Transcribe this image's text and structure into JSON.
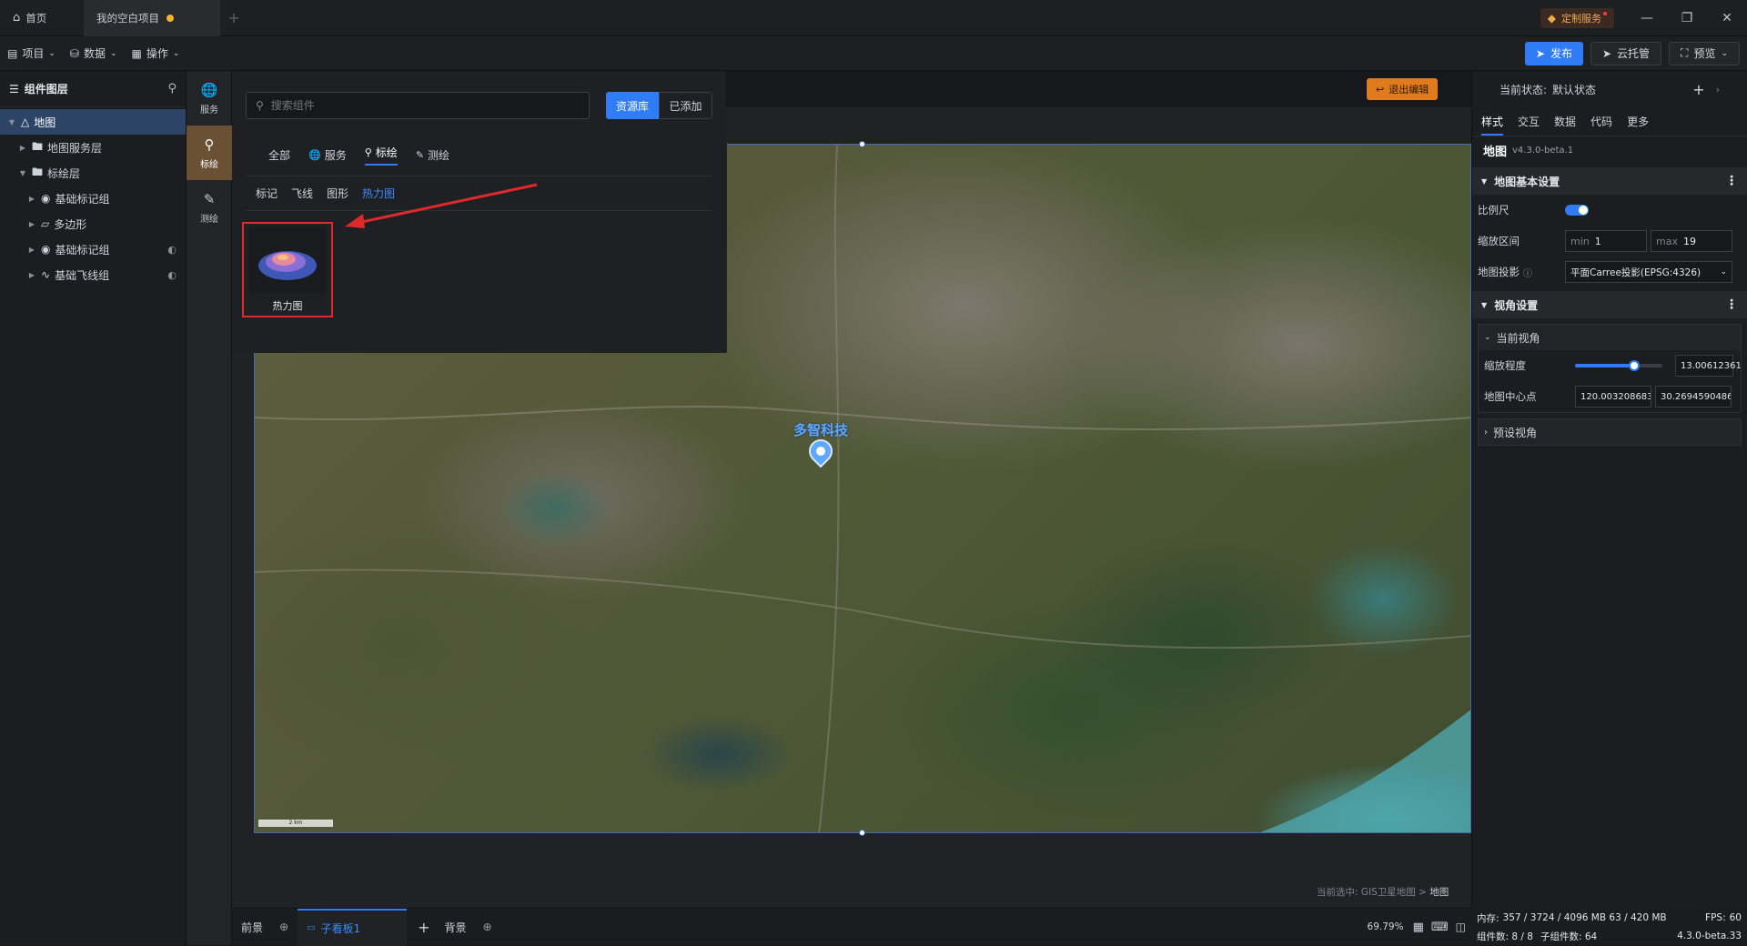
{
  "titlebar": {
    "tabs": [
      {
        "label": "首页",
        "icon": "home-icon"
      },
      {
        "label": "我的空白项目",
        "unsaved": true
      }
    ],
    "custom_service": "定制服务",
    "window_controls": [
      "minimize-icon",
      "restore-icon",
      "close-icon"
    ]
  },
  "toolbar": {
    "menus": [
      {
        "label": "项目",
        "icon": "file-icon"
      },
      {
        "label": "数据",
        "icon": "database-icon"
      },
      {
        "label": "操作",
        "icon": "grid-icon"
      }
    ],
    "publish": "发布",
    "cloud": "云托管",
    "preview": "预览"
  },
  "layers": {
    "title": "组件图层",
    "items": [
      {
        "label": "地图",
        "level": 0,
        "icon": "map-icon",
        "selected": true
      },
      {
        "label": "地图服务层",
        "level": 1,
        "icon": "folder-icon"
      },
      {
        "label": "标绘层",
        "level": 1,
        "icon": "folder-icon",
        "expanded": true
      },
      {
        "label": "基础标记组",
        "level": 2,
        "icon": "marker-group-icon"
      },
      {
        "label": "多边形",
        "level": 2,
        "icon": "polygon-icon"
      },
      {
        "label": "基础标记组",
        "level": 2,
        "icon": "marker-group-icon",
        "hidden": true
      },
      {
        "label": "基础飞线组",
        "level": 2,
        "icon": "flyline-icon",
        "hidden": true
      }
    ]
  },
  "rail": [
    {
      "label": "服务",
      "icon": "globe-icon"
    },
    {
      "label": "标绘",
      "icon": "pin-icon",
      "active": true
    },
    {
      "label": "测绘",
      "icon": "survey-icon"
    }
  ],
  "picker": {
    "search_placeholder": "搜索组件",
    "library": "资源库",
    "added": "已添加",
    "categories": [
      {
        "label": "全部",
        "icon": ""
      },
      {
        "label": "服务",
        "icon": "globe-icon"
      },
      {
        "label": "标绘",
        "icon": "pin-icon",
        "active": true
      },
      {
        "label": "测绘",
        "icon": "survey-icon"
      }
    ],
    "subcategories": [
      {
        "label": "标记"
      },
      {
        "label": "飞线"
      },
      {
        "label": "图形"
      },
      {
        "label": "热力图",
        "active": true
      }
    ],
    "card": {
      "label": "热力图"
    }
  },
  "canvas": {
    "exit_edit": "退出编辑",
    "map_label": "多智科技",
    "scale_text": "2 km",
    "current_selection_prefix": "当前选中: GIS卫星地图 > ",
    "current_selection_target": "地图"
  },
  "props": {
    "state_label": "当前状态:",
    "state_value": "默认状态",
    "tabs": [
      {
        "label": "样式",
        "active": true
      },
      {
        "label": "交互"
      },
      {
        "label": "数据"
      },
      {
        "label": "代码"
      },
      {
        "label": "更多"
      }
    ],
    "component_name": "地图",
    "component_version": "v4.3.0-beta.1",
    "basic_section": "地图基本设置",
    "scale_label": "比例尺",
    "scale_enabled": true,
    "zoom_range_label": "缩放区间",
    "zoom_min_prefix": "min",
    "zoom_min": "1",
    "zoom_max_prefix": "max",
    "zoom_max": "19",
    "projection_label": "地图投影",
    "projection_value": "平面Carree投影(EPSG:4326)",
    "view_section": "视角设置",
    "current_view": "当前视角",
    "zoom_level_label": "缩放程度",
    "zoom_level_value": "13.00612361",
    "zoom_slider_fraction": 0.68,
    "center_label": "地图中心点",
    "center_lng": "120.0032086831",
    "center_lat": "30.2694590486",
    "preset_view": "预设视角"
  },
  "bottom": {
    "tabs": [
      {
        "label": "前景"
      },
      {
        "label": "子看板1",
        "active": true
      },
      {
        "label": "背景"
      }
    ],
    "zoom": "69.79%"
  },
  "status": {
    "memory_label": "内存:",
    "memory_value": "357 / 3724 / 4096 MB  63 / 420 MB",
    "fps_label": "FPS:",
    "fps_value": "60",
    "components_label": "组件数: 8 / 8",
    "sub_components_label": "子组件数: 64",
    "version": "4.3.0-beta.33"
  }
}
